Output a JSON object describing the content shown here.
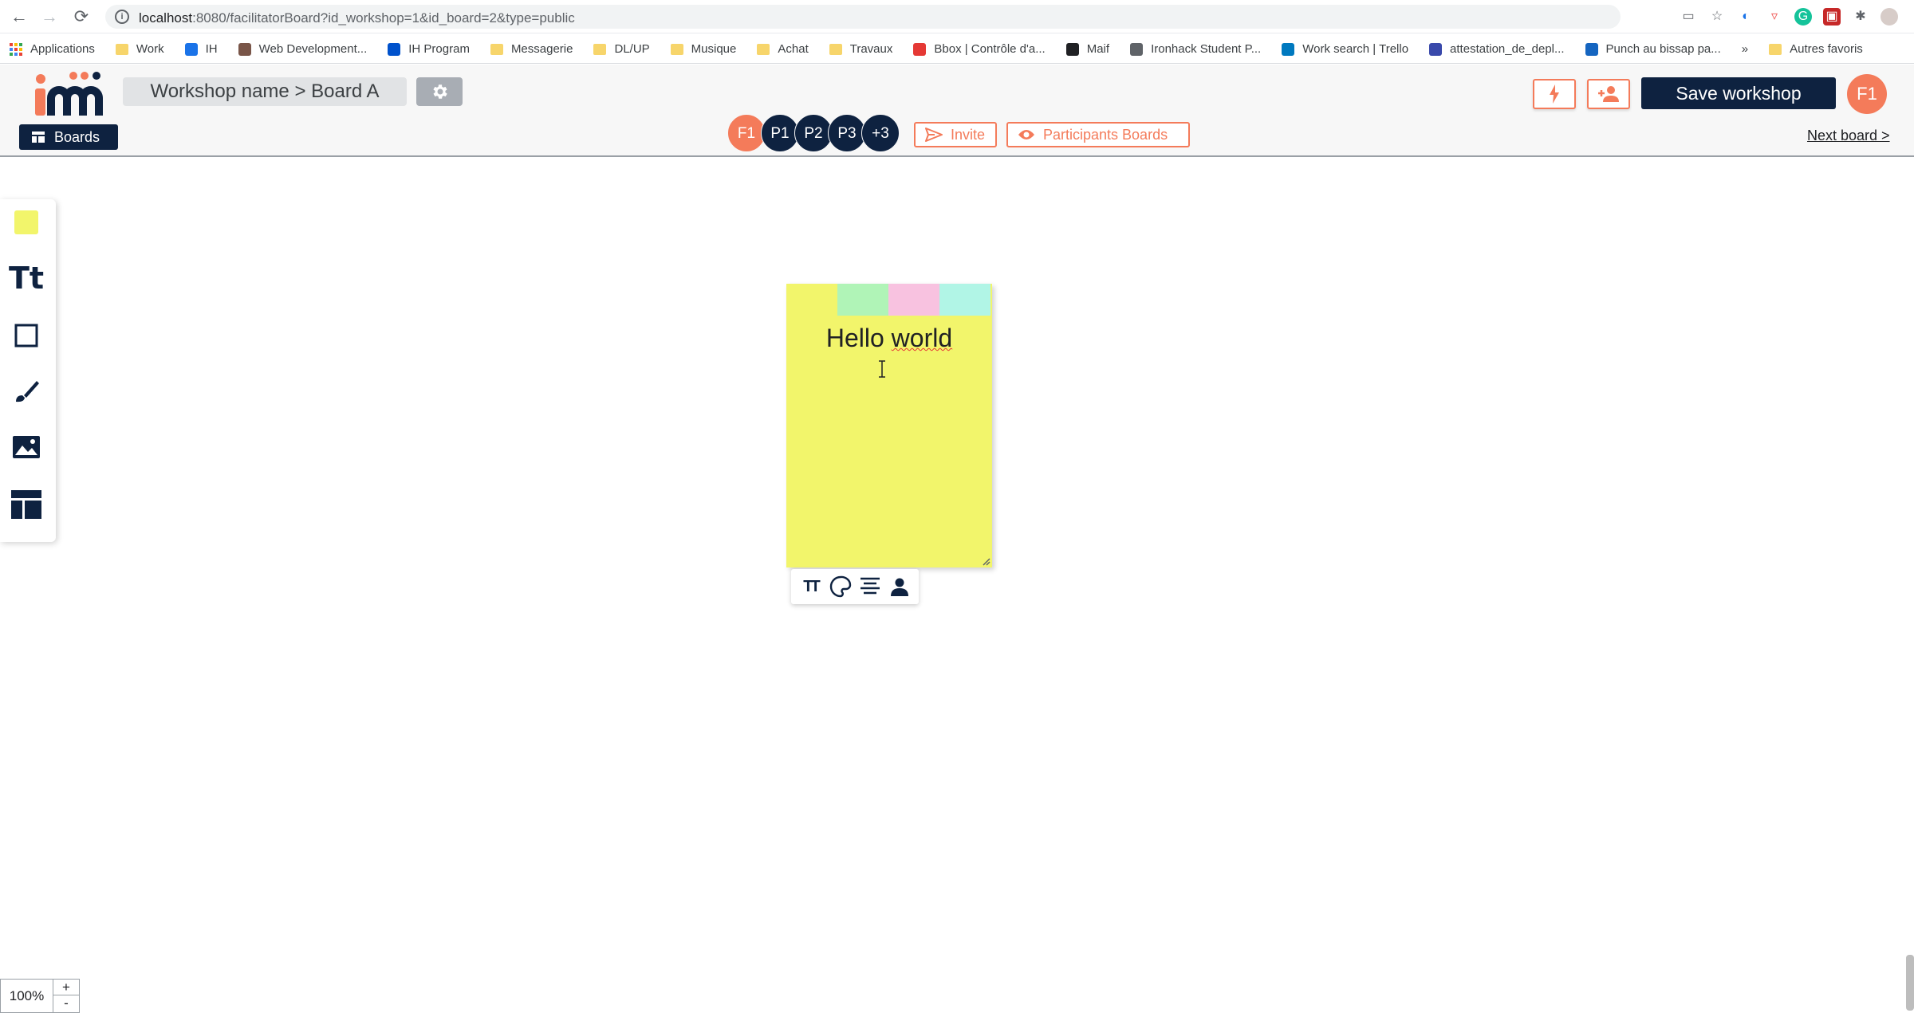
{
  "browser": {
    "url_host": "localhost",
    "url_rest": ":8080/facilitatorBoard?id_workshop=1&id_board=2&type=public",
    "bookmarks": [
      {
        "label": "Applications",
        "kind": "apps"
      },
      {
        "label": "Work",
        "kind": "folder"
      },
      {
        "label": "IH",
        "kind": "fav",
        "color": "#1a73e8"
      },
      {
        "label": "Web Development...",
        "kind": "fav",
        "color": "#795548"
      },
      {
        "label": "IH Program",
        "kind": "fav",
        "color": "#0052cc"
      },
      {
        "label": "Messagerie",
        "kind": "folder"
      },
      {
        "label": "DL/UP",
        "kind": "folder"
      },
      {
        "label": "Musique",
        "kind": "folder"
      },
      {
        "label": "Achat",
        "kind": "folder"
      },
      {
        "label": "Travaux",
        "kind": "folder"
      },
      {
        "label": "Bbox | Contrôle d'a...",
        "kind": "fav",
        "color": "#e53935"
      },
      {
        "label": "Maif",
        "kind": "fav",
        "color": "#202124"
      },
      {
        "label": "Ironhack Student P...",
        "kind": "fav",
        "color": "#5f6368"
      },
      {
        "label": "Work search | Trello",
        "kind": "fav",
        "color": "#0079bf"
      },
      {
        "label": "attestation_de_depl...",
        "kind": "fav",
        "color": "#3949ab"
      },
      {
        "label": "Punch au bissap pa...",
        "kind": "fav",
        "color": "#1565c0"
      }
    ],
    "bookmarks_more": "»",
    "other_bookmarks": "Autres favoris"
  },
  "header": {
    "breadcrumb": "Workshop name > Board A",
    "boards_label": "Boards",
    "participants": [
      "F1",
      "P1",
      "P2",
      "P3",
      "+3"
    ],
    "invite_label": "Invite",
    "participants_boards_label": "Participants Boards",
    "save_label": "Save workshop",
    "user_initials": "F1",
    "next_board_label": "Next board >"
  },
  "toolbar": {
    "text_tool_label": "Tt"
  },
  "sticky_note": {
    "text_before": "Hello ",
    "text_wavy": "world",
    "color": "#f2f56b",
    "swatches": [
      "#a5f3c4",
      "#f9b8f4",
      "#a6f5fb"
    ]
  },
  "note_toolbar": {
    "font_size_label": "TT"
  },
  "zoom": {
    "value": "100%",
    "in_label": "+",
    "out_label": "-"
  },
  "colors": {
    "accent": "#f47b5a",
    "navy": "#0e2240"
  }
}
